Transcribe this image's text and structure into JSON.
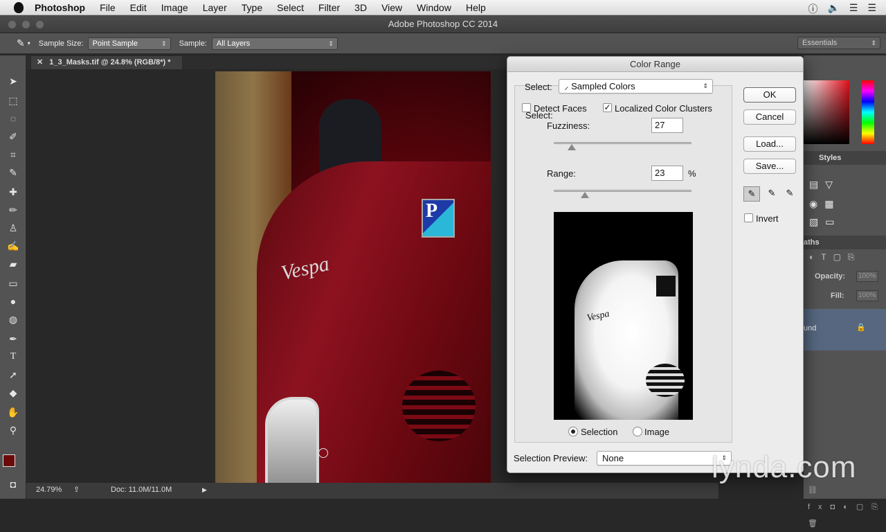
{
  "menubar": {
    "app": "Photoshop",
    "items": [
      "File",
      "Edit",
      "Image",
      "Layer",
      "Type",
      "Select",
      "Filter",
      "3D",
      "View",
      "Window",
      "Help"
    ]
  },
  "window": {
    "title": "Adobe Photoshop CC 2014"
  },
  "options": {
    "sample_size_label": "Sample Size:",
    "sample_size_value": "Point Sample",
    "sample_label": "Sample:",
    "sample_value": "All Layers",
    "workspace": "Essentials"
  },
  "document": {
    "tab_title": "1_3_Masks.tif @ 24.8% (RGB/8*) *",
    "zoom": "24.79%",
    "doc_size": "Doc: 11.0M/11.0M"
  },
  "panels": {
    "styles_tab": "Styles",
    "paths_tab": "aths",
    "opacity_label": "Opacity:",
    "opacity_value": "100%",
    "fill_label": "Fill:",
    "fill_value": "100%",
    "layer_name": "und"
  },
  "dialog": {
    "title": "Color Range",
    "select_label": "Select:",
    "select_value": "Sampled Colors",
    "detect_faces": "Detect Faces",
    "localized": "Localized Color Clusters",
    "fuzziness_label": "Fuzziness:",
    "fuzziness_value": "27",
    "range_label": "Range:",
    "range_value": "23",
    "range_unit": "%",
    "radio_selection": "Selection",
    "radio_image": "Image",
    "preview_label": "Selection Preview:",
    "preview_value": "None",
    "buttons": {
      "ok": "OK",
      "cancel": "Cancel",
      "load": "Load...",
      "save": "Save..."
    },
    "invert": "Invert",
    "preview_text": "Vespa"
  },
  "photo": {
    "badge_letter": "P",
    "logo_text": "Vespa"
  },
  "watermark": "lynda.com"
}
